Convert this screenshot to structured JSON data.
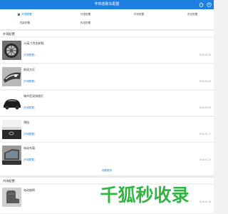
{
  "header": {
    "title": "丰田逸致车配置"
  },
  "tabs": [
    "外观配置",
    "外观配置",
    "内饰配置",
    "安全配置",
    "性能配置",
    "科技配置"
  ],
  "sections": [
    {
      "title": "外观配置",
      "items": [
        {
          "title": "19英寸合金轮毂",
          "tag": "[外观配置]",
          "date": "2018-04-25"
        },
        {
          "title": "前双大灯",
          "tag": "[外观配置]",
          "date": "2018-04-25"
        },
        {
          "title": "城市型双排放灯",
          "tag": "[外观配置]",
          "date": "2018-05-09"
        },
        {
          "title": "预档",
          "tag": "[外观配置]",
          "date": "2018-01-17"
        },
        {
          "title": "电动车窗",
          "tag": "[外观配置]",
          "date": "2018-01-17"
        }
      ],
      "more": "查看更多"
    },
    {
      "title": "内饰配置",
      "items": [
        {
          "title": "电动座椅",
          "tag": "",
          "date": "2018-01-18"
        }
      ]
    }
  ],
  "watermark": "千狐秒收录",
  "colors": {
    "accent": "#1e7fe0",
    "watermark": "#31b441"
  }
}
